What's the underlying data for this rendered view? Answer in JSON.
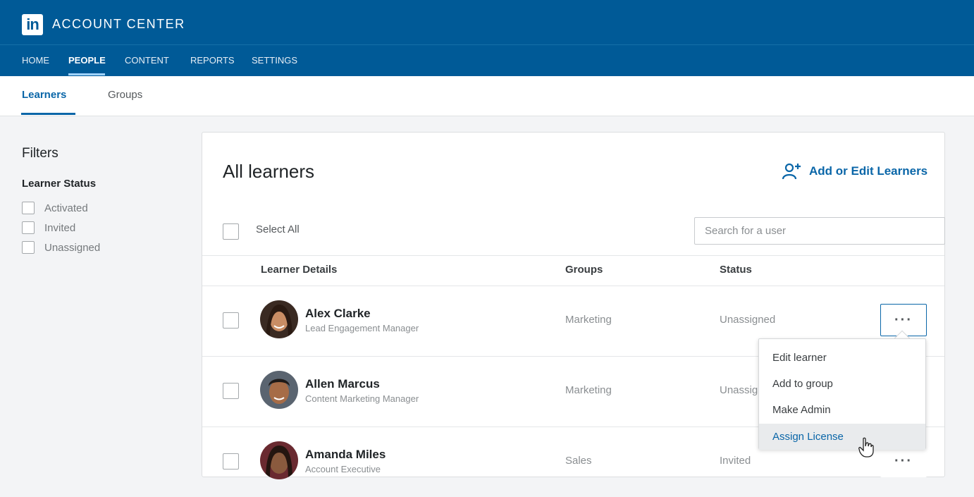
{
  "header": {
    "logo_text": "in",
    "app_title": "ACCOUNT CENTER"
  },
  "nav": {
    "items": [
      {
        "label": "HOME",
        "active": false
      },
      {
        "label": "PEOPLE",
        "active": true
      },
      {
        "label": "CONTENT",
        "active": false
      },
      {
        "label": "REPORTS",
        "active": false
      },
      {
        "label": "SETTINGS",
        "active": false
      }
    ]
  },
  "subtabs": [
    {
      "label": "Learners",
      "active": true
    },
    {
      "label": "Groups",
      "active": false
    }
  ],
  "filters": {
    "title": "Filters",
    "group_title": "Learner Status",
    "options": [
      "Activated",
      "Invited",
      "Unassigned"
    ]
  },
  "main": {
    "title": "All learners",
    "add_edit_label": "Add or Edit Learners",
    "select_all_label": "Select All",
    "search_placeholder": "Search for a user",
    "columns": {
      "details": "Learner Details",
      "groups": "Groups",
      "status": "Status"
    },
    "learners": [
      {
        "name": "Alex Clarke",
        "title": "Lead Engagement Manager",
        "group": "Marketing",
        "status": "Unassigned"
      },
      {
        "name": "Allen Marcus",
        "title": "Content Marketing Manager",
        "group": "Marketing",
        "status": "Unassigned"
      },
      {
        "name": "Amanda Miles",
        "title": "Account Executive",
        "group": "Sales",
        "status": "Invited"
      }
    ]
  },
  "menu": {
    "items": [
      "Edit learner",
      "Add to group",
      "Make Admin",
      "Assign License"
    ],
    "hovered_index": 3
  },
  "colors": {
    "brand": "#005a97",
    "accent": "#0a66a8"
  }
}
